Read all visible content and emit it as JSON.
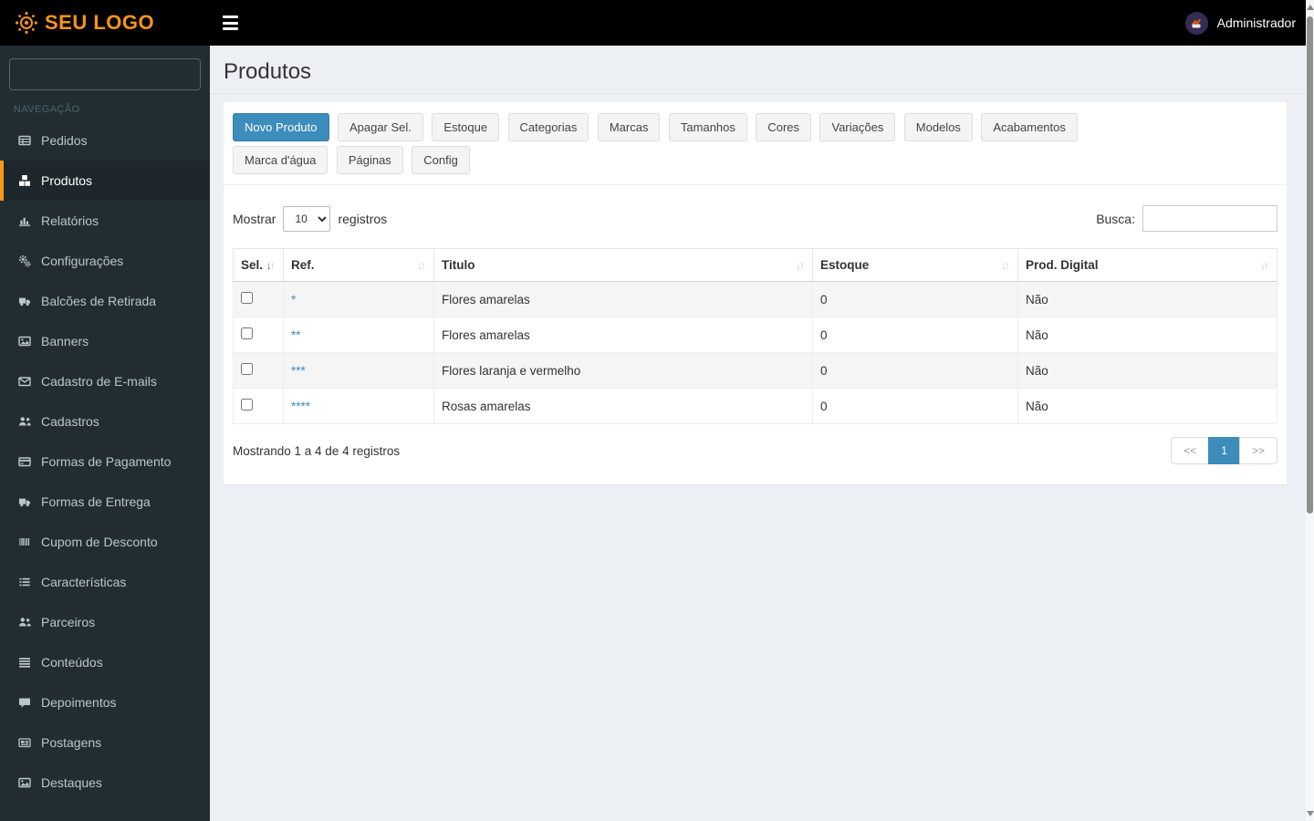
{
  "topbar": {
    "logo": "SEU LOGO",
    "user": "Administrador"
  },
  "sidebar": {
    "section_label": "NAVEGAÇÃO",
    "search_value": "",
    "items": [
      {
        "label": "Pedidos",
        "icon": "table-icon",
        "active": false
      },
      {
        "label": "Produtos",
        "icon": "cubes-icon",
        "active": true
      },
      {
        "label": "Relatórios",
        "icon": "bar-chart-icon",
        "active": false
      },
      {
        "label": "Configurações",
        "icon": "gears-icon",
        "active": false
      },
      {
        "label": "Balcões de Retirada",
        "icon": "truck-icon",
        "active": false
      },
      {
        "label": "Banners",
        "icon": "image-icon",
        "active": false
      },
      {
        "label": "Cadastro de E-mails",
        "icon": "envelope-icon",
        "active": false
      },
      {
        "label": "Cadastros",
        "icon": "users-icon",
        "active": false
      },
      {
        "label": "Formas de Pagamento",
        "icon": "credit-card-icon",
        "active": false
      },
      {
        "label": "Formas de Entrega",
        "icon": "truck-icon",
        "active": false
      },
      {
        "label": "Cupom de Desconto",
        "icon": "barcode-icon",
        "active": false
      },
      {
        "label": "Características",
        "icon": "th-list-icon",
        "active": false
      },
      {
        "label": "Parceiros",
        "icon": "users-icon",
        "active": false
      },
      {
        "label": "Conteúdos",
        "icon": "menu-lines-icon",
        "active": false
      },
      {
        "label": "Depoimentos",
        "icon": "comment-icon",
        "active": false
      },
      {
        "label": "Postagens",
        "icon": "newspaper-icon",
        "active": false
      },
      {
        "label": "Destaques",
        "icon": "image-icon",
        "active": false
      }
    ]
  },
  "page": {
    "title": "Produtos"
  },
  "toolbar": {
    "primary": "Novo Produto",
    "buttons_row1": [
      "Apagar Sel.",
      "Estoque",
      "Categorias",
      "Marcas",
      "Tamanhos",
      "Cores",
      "Variações",
      "Modelos",
      "Acabamentos"
    ],
    "buttons_row2": [
      "Marca d'água",
      "Páginas",
      "Config"
    ]
  },
  "table_controls": {
    "show_label": "Mostrar",
    "page_size": "10",
    "records_label": "registros",
    "search_label": "Busca:",
    "search_value": ""
  },
  "table": {
    "columns": [
      "Sel.",
      "Ref.",
      "Titulo",
      "Estoque",
      "Prod. Digital"
    ],
    "sorted_column": "Sel.",
    "rows": [
      {
        "ref": "*",
        "title": "Flores amarelas",
        "stock": "0",
        "digital": "Não"
      },
      {
        "ref": "**",
        "title": "Flores amarelas",
        "stock": "0",
        "digital": "Não"
      },
      {
        "ref": "***",
        "title": "Flores laranja e vermelho",
        "stock": "0",
        "digital": "Não"
      },
      {
        "ref": "****",
        "title": "Rosas amarelas",
        "stock": "0",
        "digital": "Não"
      }
    ],
    "footer_info": "Mostrando 1 a 4 de 4 registros",
    "pagination": {
      "prev": "<<",
      "current": "1",
      "next": ">>"
    }
  },
  "colors": {
    "topbar_bg": "#000000",
    "logo_orange": "#f7941d",
    "sidebar_bg": "#222d32",
    "sidebar_text": "#b8c7ce",
    "active_item_bg": "#1e282c",
    "active_border": "#f8991b",
    "accent_blue": "#3c8dbc",
    "content_bg": "#ecf0f5"
  }
}
